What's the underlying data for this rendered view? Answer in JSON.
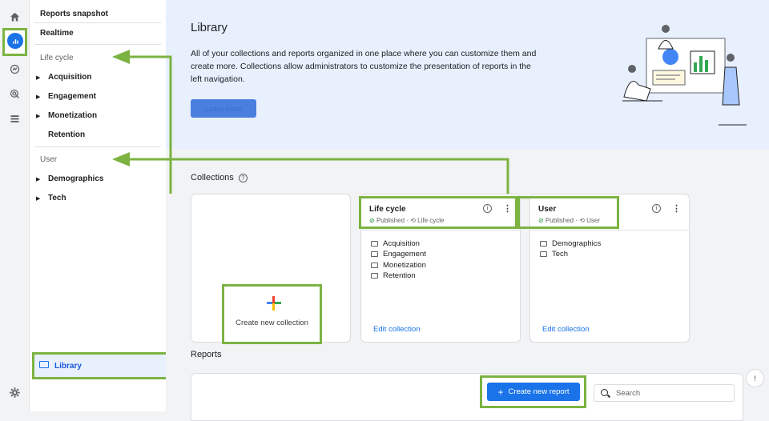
{
  "sidebar": {
    "items": {
      "reports_snapshot": "Reports snapshot",
      "realtime": "Realtime"
    },
    "sections": [
      {
        "label": "Life cycle",
        "children": [
          "Acquisition",
          "Engagement",
          "Monetization",
          "Retention"
        ]
      },
      {
        "label": "User",
        "children": [
          "Demographics",
          "Tech"
        ]
      }
    ],
    "library": "Library"
  },
  "hero": {
    "title": "Library",
    "description": "All of your collections and reports organized in one place where you can customize them and create more. Collections allow administrators to customize the presentation of reports in the left navigation.",
    "learn_more": "Learn more"
  },
  "collections": {
    "title": "Collections",
    "create_label": "Create new collection",
    "cards": [
      {
        "title": "Life cycle",
        "status": "Published",
        "source": "Life cycle",
        "folders": [
          "Acquisition",
          "Engagement",
          "Monetization",
          "Retention"
        ],
        "edit": "Edit collection"
      },
      {
        "title": "User",
        "status": "Published",
        "source": "User",
        "folders": [
          "Demographics",
          "Tech"
        ],
        "edit": "Edit collection"
      }
    ]
  },
  "reports": {
    "title": "Reports",
    "create_button": "Create new report",
    "search_placeholder": "Search"
  },
  "colors": {
    "accent": "#1a73e8",
    "highlight": "#7cb342",
    "hero_bg": "#e8f0fe"
  }
}
